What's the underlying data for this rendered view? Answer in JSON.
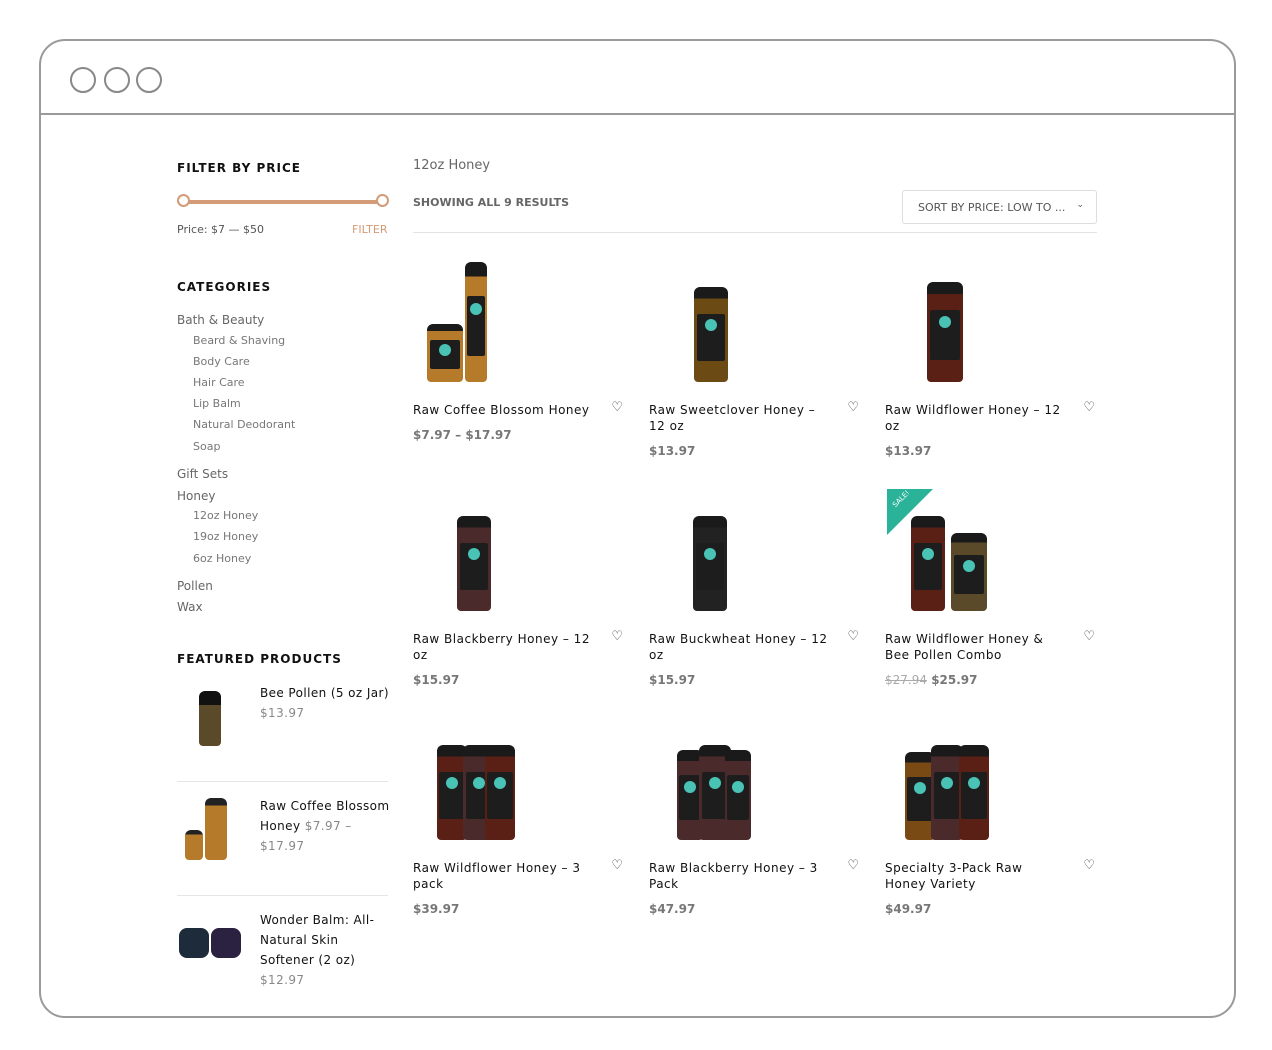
{
  "window": {
    "controls": [
      "close",
      "minimize",
      "maximize"
    ]
  },
  "sidebar": {
    "filter_heading": "FILTER BY PRICE",
    "price_range": {
      "min": 7,
      "max": 50,
      "label": "Price: $7 — $50"
    },
    "filter_button": "FILTER",
    "categories_heading": "CATEGORIES",
    "categories": [
      {
        "label": "Bath & Beauty",
        "children": [
          "Beard & Shaving",
          "Body Care",
          "Hair Care",
          "Lip Balm",
          "Natural Deodorant",
          "Soap"
        ]
      },
      {
        "label": "Gift Sets",
        "children": []
      },
      {
        "label": "Honey",
        "children": [
          "12oz Honey",
          "19oz Honey",
          "6oz Honey"
        ]
      },
      {
        "label": "Pollen",
        "children": []
      },
      {
        "label": "Wax",
        "children": []
      }
    ],
    "featured_heading": "FEATURED PRODUCTS",
    "featured": [
      {
        "name": "Bee Pollen (5 oz Jar)",
        "price": "$13.97"
      },
      {
        "name": "Raw Coffee Blossom Honey",
        "price": "$7.97 – $17.97"
      },
      {
        "name": "Wonder Balm: All-Natural Skin Softener (2 oz)",
        "price": "$12.97"
      }
    ]
  },
  "main": {
    "breadcrumb": "12oz Honey",
    "result_count": "SHOWING ALL 9 RESULTS",
    "sort_selected": "SORT BY PRICE: LOW TO ...",
    "sale_badge": "SALE!",
    "products": [
      {
        "name": "Raw Coffee Blossom Honey",
        "price": "$7.97 – $17.97"
      },
      {
        "name": "Raw Sweetclover Honey – 12 oz",
        "price": "$13.97"
      },
      {
        "name": "Raw Wildflower Honey – 12 oz",
        "price": "$13.97"
      },
      {
        "name": "Raw Blackberry Honey – 12 oz",
        "price": "$15.97"
      },
      {
        "name": "Raw Buckwheat Honey – 12 oz",
        "price": "$15.97"
      },
      {
        "name": "Raw Wildflower Honey & Bee Pollen Combo",
        "old_price": "$27.94",
        "price": "$25.97",
        "on_sale": true
      },
      {
        "name": "Raw Wildflower Honey – 3 pack",
        "price": "$39.97"
      },
      {
        "name": "Raw Blackberry Honey – 3 Pack",
        "price": "$47.97"
      },
      {
        "name": "Specialty 3-Pack Raw Honey Variety",
        "price": "$49.97"
      }
    ]
  },
  "colors": {
    "accent": "#d39b77",
    "sale": "#2bb39a"
  }
}
